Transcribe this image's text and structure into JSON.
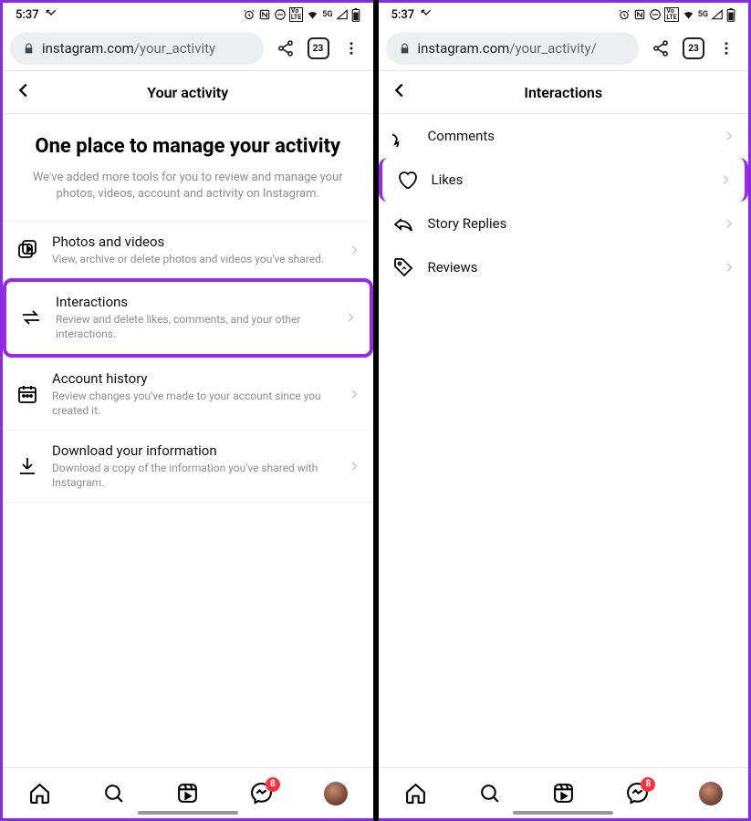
{
  "status": {
    "time": "5:37",
    "icons": [
      "alarm",
      "nfc",
      "dnd",
      "volte",
      "wifi",
      "5g",
      "signal",
      "battery"
    ]
  },
  "browser": {
    "lock": true,
    "domain": "instagram.com",
    "path_left": "/your_activity",
    "path_right": "/your_activity/",
    "tab_count": "23"
  },
  "left": {
    "header_title": "Your activity",
    "intro_title": "One place to manage your activity",
    "intro_desc": "We've added more tools for you to review and manage your photos, videos, account and activity on Instagram.",
    "items": [
      {
        "title": "Photos and videos",
        "desc": "View, archive or delete photos and videos you've shared.",
        "icon": "photos"
      },
      {
        "title": "Interactions",
        "desc": "Review and delete likes, comments, and your other interactions.",
        "icon": "interactions",
        "highlight": true
      },
      {
        "title": "Account history",
        "desc": "Review changes you've made to your account since you created it.",
        "icon": "calendar"
      },
      {
        "title": "Download your information",
        "desc": "Download a copy of the information you've shared with Instagram.",
        "icon": "download"
      }
    ]
  },
  "right": {
    "header_title": "Interactions",
    "items": [
      {
        "title": "Comments",
        "icon": "comment"
      },
      {
        "title": "Likes",
        "icon": "heart",
        "highlight": true
      },
      {
        "title": "Story Replies",
        "icon": "reply"
      },
      {
        "title": "Reviews",
        "icon": "tag"
      }
    ]
  },
  "nav": {
    "badge": "8"
  }
}
